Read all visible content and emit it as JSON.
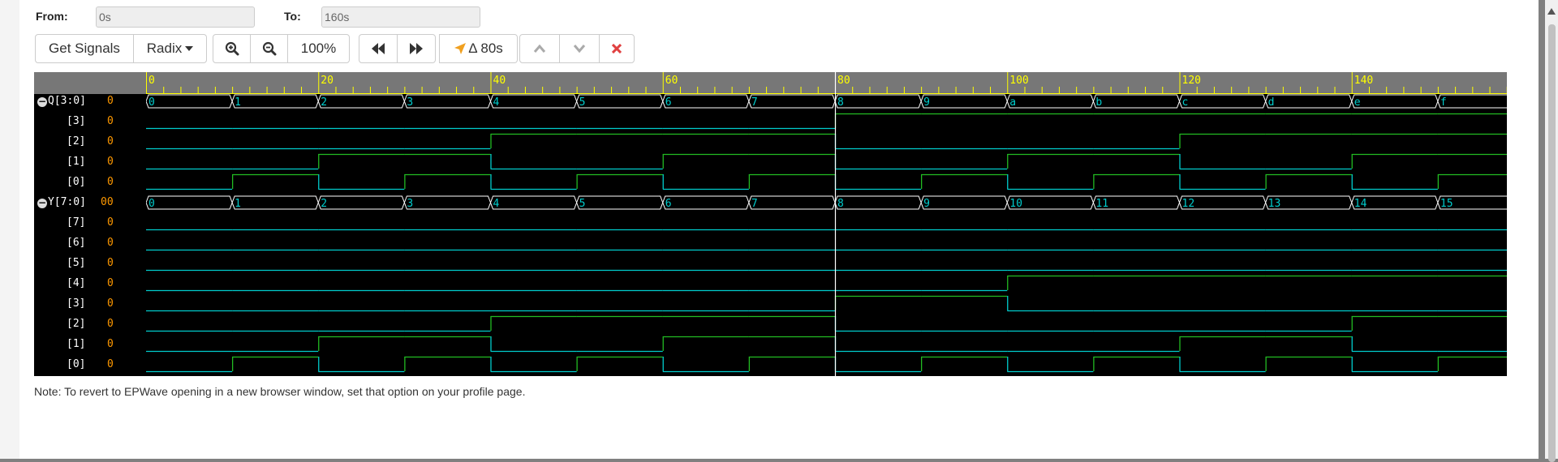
{
  "range": {
    "from_label": "From:",
    "from_value": "0s",
    "to_label": "To:",
    "to_value": "160s"
  },
  "toolbar": {
    "get_signals": "Get Signals",
    "radix": "Radix",
    "zoom_level": "100%",
    "delta": "Δ 80s"
  },
  "colors": {
    "wave_low": "#00cccc",
    "wave_high": "#22bb22",
    "bus": "#ffffff",
    "bus_text": "#00cccc",
    "ruler_text": "#ffff00",
    "values": "#ff9900",
    "cursor": "#ffffff"
  },
  "ruler": {
    "ticks": [
      "0",
      "20",
      "40",
      "60",
      "80",
      "100",
      "120",
      "140"
    ]
  },
  "signals": [
    {
      "name": "Q[3:0]",
      "value": "0",
      "type": "bus",
      "collapsible": true,
      "segments": [
        "0",
        "1",
        "2",
        "3",
        "4",
        "5",
        "6",
        "7",
        "8",
        "9",
        "a",
        "b",
        "c",
        "d",
        "e",
        "f"
      ]
    },
    {
      "name": "[3]",
      "value": "0",
      "type": "bit",
      "bits": [
        0,
        0,
        0,
        0,
        0,
        0,
        0,
        0,
        1,
        1,
        1,
        1,
        1,
        1,
        1,
        1
      ]
    },
    {
      "name": "[2]",
      "value": "0",
      "type": "bit",
      "bits": [
        0,
        0,
        0,
        0,
        1,
        1,
        1,
        1,
        0,
        0,
        0,
        0,
        1,
        1,
        1,
        1
      ]
    },
    {
      "name": "[1]",
      "value": "0",
      "type": "bit",
      "bits": [
        0,
        0,
        1,
        1,
        0,
        0,
        1,
        1,
        0,
        0,
        1,
        1,
        0,
        0,
        1,
        1
      ]
    },
    {
      "name": "[0]",
      "value": "0",
      "type": "bit",
      "bits": [
        0,
        1,
        0,
        1,
        0,
        1,
        0,
        1,
        0,
        1,
        0,
        1,
        0,
        1,
        0,
        1
      ]
    },
    {
      "name": "Y[7:0]",
      "value": "00",
      "type": "bus",
      "collapsible": true,
      "segments": [
        "0",
        "1",
        "2",
        "3",
        "4",
        "5",
        "6",
        "7",
        "8",
        "9",
        "10",
        "11",
        "12",
        "13",
        "14",
        "15"
      ]
    },
    {
      "name": "[7]",
      "value": "0",
      "type": "bit",
      "bits": [
        0,
        0,
        0,
        0,
        0,
        0,
        0,
        0,
        0,
        0,
        0,
        0,
        0,
        0,
        0,
        0
      ]
    },
    {
      "name": "[6]",
      "value": "0",
      "type": "bit",
      "bits": [
        0,
        0,
        0,
        0,
        0,
        0,
        0,
        0,
        0,
        0,
        0,
        0,
        0,
        0,
        0,
        0
      ]
    },
    {
      "name": "[5]",
      "value": "0",
      "type": "bit",
      "bits": [
        0,
        0,
        0,
        0,
        0,
        0,
        0,
        0,
        0,
        0,
        0,
        0,
        0,
        0,
        0,
        0
      ]
    },
    {
      "name": "[4]",
      "value": "0",
      "type": "bit",
      "bits": [
        0,
        0,
        0,
        0,
        0,
        0,
        0,
        0,
        0,
        0,
        1,
        1,
        1,
        1,
        1,
        1
      ]
    },
    {
      "name": "[3]",
      "value": "0",
      "type": "bit",
      "bits": [
        0,
        0,
        0,
        0,
        0,
        0,
        0,
        0,
        1,
        1,
        0,
        0,
        0,
        0,
        0,
        0
      ]
    },
    {
      "name": "[2]",
      "value": "0",
      "type": "bit",
      "bits": [
        0,
        0,
        0,
        0,
        1,
        1,
        1,
        1,
        0,
        0,
        0,
        0,
        0,
        0,
        1,
        1
      ]
    },
    {
      "name": "[1]",
      "value": "0",
      "type": "bit",
      "bits": [
        0,
        0,
        1,
        1,
        0,
        0,
        1,
        1,
        0,
        0,
        0,
        0,
        1,
        1,
        0,
        0
      ]
    },
    {
      "name": "[0]",
      "value": "0",
      "type": "bit",
      "bits": [
        0,
        1,
        0,
        1,
        0,
        1,
        0,
        1,
        0,
        1,
        0,
        1,
        0,
        1,
        0,
        1
      ]
    }
  ],
  "cursor_time": 80,
  "note": "Note: To revert to EPWave opening in a new browser window, set that option on your profile page."
}
